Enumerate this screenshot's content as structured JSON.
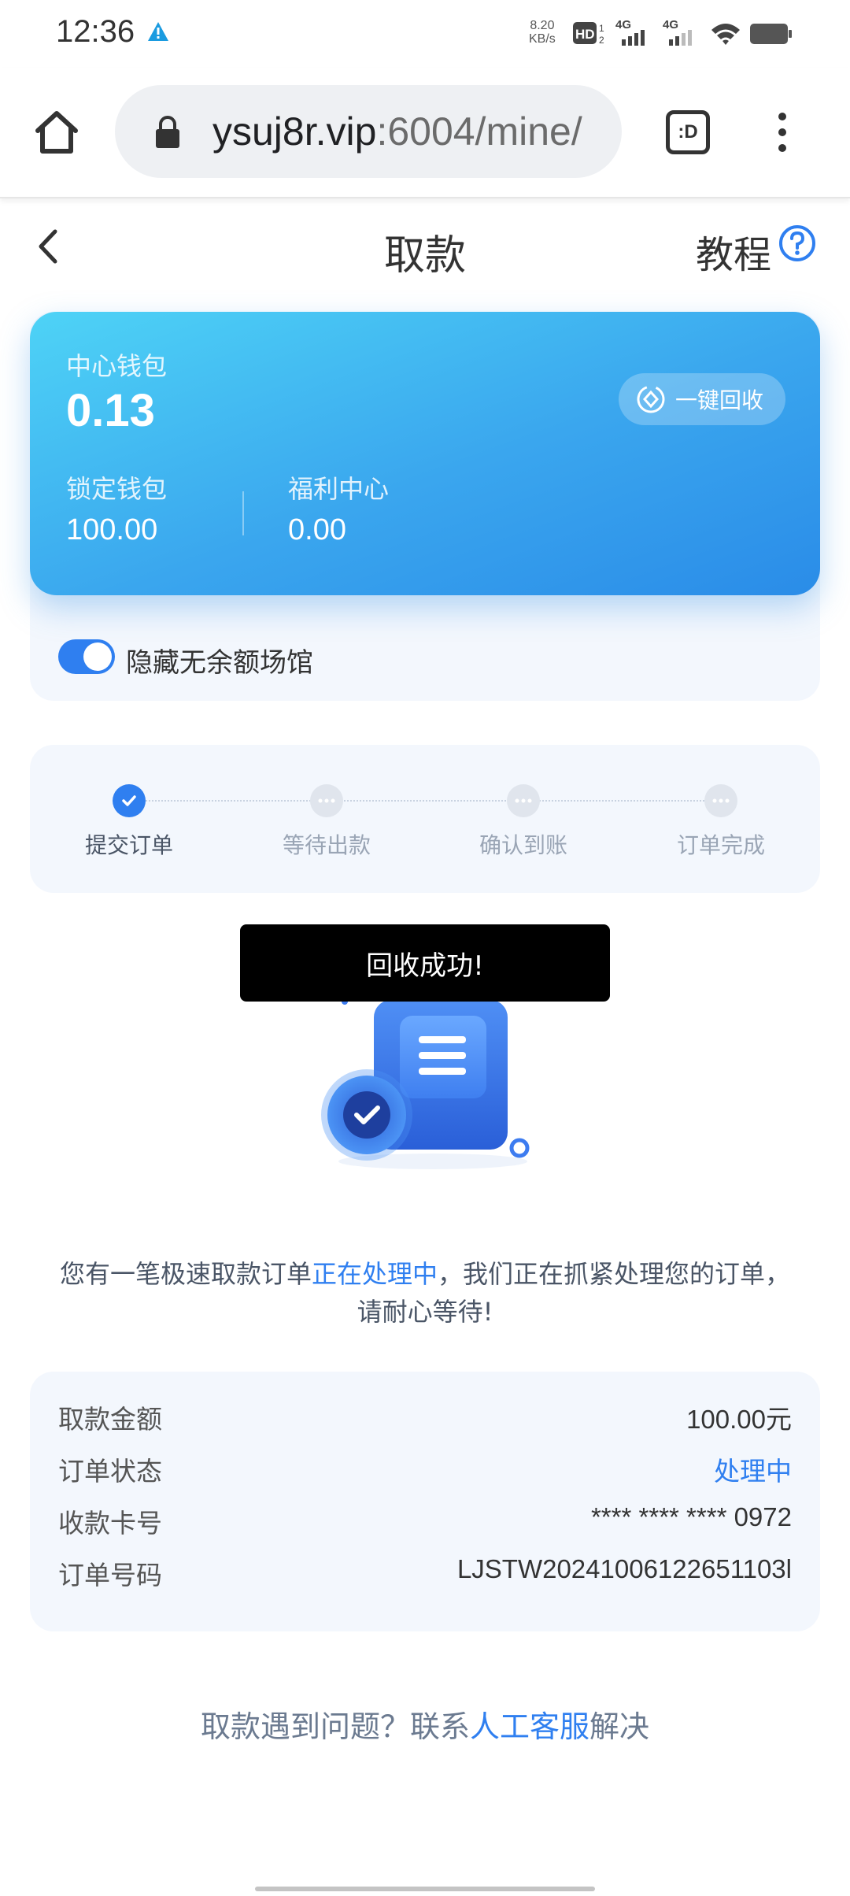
{
  "status_bar": {
    "time": "12:36",
    "speed_value": "8.20",
    "speed_unit": "KB/s",
    "hd_label": "HD",
    "sim1": "4G",
    "sim2": "4G"
  },
  "browser": {
    "url_host": "ysuj8r.vip",
    "url_path": ":6004/mine/",
    "tabs_label": ":D"
  },
  "header": {
    "title": "取款",
    "tutorial_label": "教程"
  },
  "wallet": {
    "center_label": "中心钱包",
    "center_value": "0.13",
    "locked_label": "锁定钱包",
    "locked_value": "100.00",
    "welfare_label": "福利中心",
    "welfare_value": "0.00",
    "recycle_label": "一键回收"
  },
  "toggle": {
    "label": "隐藏无余额场馆",
    "on": true
  },
  "steps": [
    {
      "label": "提交订单",
      "done": true
    },
    {
      "label": "等待出款",
      "done": false
    },
    {
      "label": "确认到账",
      "done": false
    },
    {
      "label": "订单完成",
      "done": false
    }
  ],
  "toast": {
    "text": "回收成功!"
  },
  "message": {
    "part1": "您有一笔极速取款订单",
    "highlight": "正在处理中",
    "part2": "，我们正在抓紧处理您的订单，",
    "line2": "请耐心等待!"
  },
  "details": {
    "amount_label": "取款金额",
    "amount_value": "100.00元",
    "status_label": "订单状态",
    "status_value": "处理中",
    "card_label": "收款卡号",
    "card_value": "**** **** **** 0972",
    "order_label": "订单号码",
    "order_value": "LJSTW20241006122651103l"
  },
  "help": {
    "prefix": "取款遇到问题？联系",
    "link": "人工客服",
    "suffix": "解决"
  },
  "colors": {
    "accent": "#2f7ff0",
    "card_gradient_start": "#4ed3f6",
    "card_gradient_end": "#2a8ce8"
  }
}
